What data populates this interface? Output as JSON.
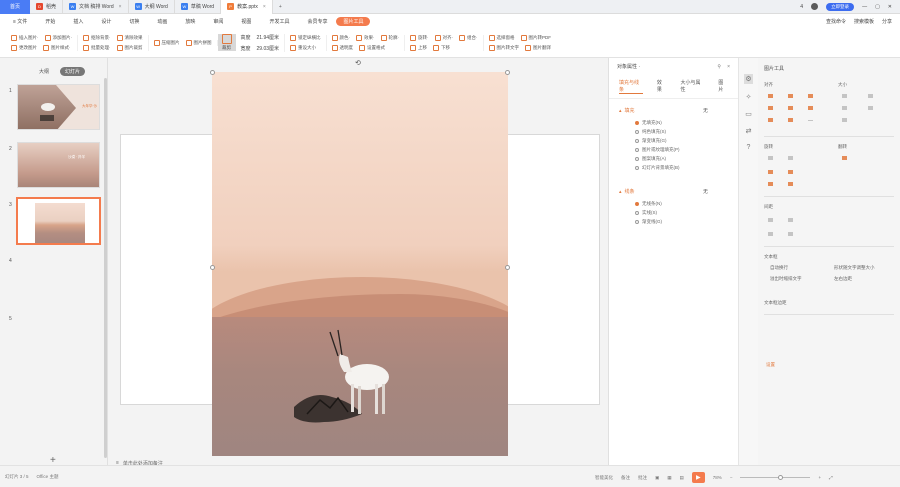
{
  "titlebar": {
    "home": "首页",
    "tabs": [
      {
        "label": "稻壳",
        "color": "#e5472d",
        "icon": "D",
        "active": false
      },
      {
        "label": "文档 稿排 Word",
        "color": "#3a7ff0",
        "icon": "W",
        "active": false
      },
      {
        "label": "大纲 Word",
        "color": "#3a7ff0",
        "icon": "W",
        "active": false
      },
      {
        "label": "草稿 Word",
        "color": "#3a7ff0",
        "icon": "W",
        "active": false
      },
      {
        "label": "教案.pptx",
        "color": "#f07c3a",
        "icon": "P",
        "active": true
      }
    ],
    "right": {
      "count": "4",
      "login": "立即登录"
    }
  },
  "menubar": {
    "file": "≡ 文件",
    "items": [
      "开始",
      "插入",
      "设计",
      "切换",
      "动画",
      "放映",
      "审阅",
      "视图",
      "开发工具",
      "会员专享"
    ],
    "active": "图片工具",
    "right": [
      "查找命令",
      "搜索模板",
      "分享"
    ]
  },
  "ribbon": {
    "groups": [
      {
        "rows": [
          [
            "插入图片·",
            "添加图片·"
          ],
          [
            "更改图片",
            "图片样式·"
          ]
        ]
      },
      {
        "rows": [
          [
            "抠除背景·",
            "清除效果"
          ],
          [
            "批量处理·",
            "图片裁剪"
          ]
        ]
      },
      {
        "rows": [
          [
            "压缩图片",
            "图片拼图"
          ]
        ]
      },
      {
        "big": "裁剪",
        "selected": true
      },
      {
        "rows": [
          [
            "高度",
            "21.94厘米"
          ],
          [
            "宽度",
            "29.03厘米"
          ]
        ]
      },
      {
        "rows": [
          [
            "锁定纵横比",
            "重设大小"
          ]
        ]
      },
      {
        "rows": [
          [
            "颜色·",
            "效果·",
            "轮廓·"
          ],
          [
            "透明度",
            "设置格式"
          ]
        ]
      },
      {
        "rows": [
          [
            "旋转·",
            "对齐·",
            "组合·"
          ],
          [
            "上移",
            "下移"
          ]
        ]
      },
      {
        "rows": [
          [
            "选择窗格",
            "图片转PDF"
          ],
          [
            "图片转文字",
            "图片翻译"
          ]
        ]
      }
    ]
  },
  "leftpane": {
    "tabs": [
      "大纲",
      "幻灯片"
    ],
    "slides": [
      "1",
      "2",
      "3",
      "4",
      "5"
    ],
    "thumb1_text": "大年华·沙",
    "thumb2_text": "沙漠 · 羚羊",
    "add": "+"
  },
  "rightpane": {
    "title": "对象属性 ·",
    "tabs": [
      "填充与线条",
      "效果",
      "大小与属性",
      "图片"
    ],
    "fill": {
      "header": "填充",
      "value": "无",
      "options": [
        {
          "label": "无填充(N)",
          "type": "radio",
          "on": true
        },
        {
          "label": "纯色填充(S)",
          "type": "radio",
          "on": false
        },
        {
          "label": "渐变填充(G)",
          "type": "radio",
          "on": false
        },
        {
          "label": "图片或纹理填充(P)",
          "type": "radio",
          "on": false
        },
        {
          "label": "图案填充(A)",
          "type": "radio",
          "on": false
        },
        {
          "label": "幻灯片背景填充(B)",
          "type": "radio",
          "on": false
        }
      ]
    },
    "line": {
      "header": "线条",
      "value": "无",
      "options": [
        {
          "label": "无线条(N)",
          "type": "radio",
          "on": true
        },
        {
          "label": "实线(S)",
          "type": "radio",
          "on": false
        },
        {
          "label": "渐变线(G)",
          "type": "radio",
          "on": false
        }
      ]
    }
  },
  "toolpane": {
    "title": "图片工具",
    "sections": [
      "对齐",
      "大小",
      "旋转",
      "翻转",
      "间距",
      "文本框",
      "文本框边距"
    ],
    "textbox_opts": [
      "自动换行",
      "形状随文字调整大小"
    ],
    "textbox_opts2": [
      "溢出时缩排文字",
      "左右边距"
    ],
    "settings": "设置"
  },
  "notes": {
    "icon": "≡",
    "placeholder": "单击此处添加备注"
  },
  "status": {
    "slide_info": "幻灯片 3 / 5",
    "theme": "Office 主题",
    "right": [
      "智能美化",
      "备注",
      "批注"
    ],
    "zoom": "78%"
  }
}
